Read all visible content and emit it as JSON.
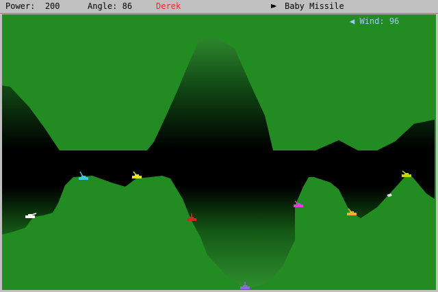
{
  "status": {
    "power_label": "Power:",
    "power_value": "200",
    "angle_label": "Angle:",
    "angle_value": "86",
    "current_player": "Derek",
    "current_player_color": "#ff2020",
    "weapon_icon": "missile-icon",
    "weapon_name": "Baby Missile"
  },
  "wind": {
    "direction_icon": "arrow-left-icon",
    "label": "Wind:",
    "value": "96",
    "color": "#a9c6ff"
  },
  "colors": {
    "terrain": "#228b22",
    "sky_dark": "#000000",
    "border": "#c0c0c0"
  },
  "tanks": [
    {
      "color": "#ffffff",
      "turret": "right"
    },
    {
      "color": "#3ec8e6",
      "turret": "left"
    },
    {
      "color": "#e6e62a",
      "turret": "left"
    },
    {
      "color": "#e02020",
      "turret": "up"
    },
    {
      "color": "#8a6ae6",
      "turret": "up"
    },
    {
      "color": "#e040e0",
      "turret": "left"
    },
    {
      "color": "#f0b030",
      "turret": "left"
    },
    {
      "color": "#c8d800",
      "turret": "left"
    }
  ]
}
